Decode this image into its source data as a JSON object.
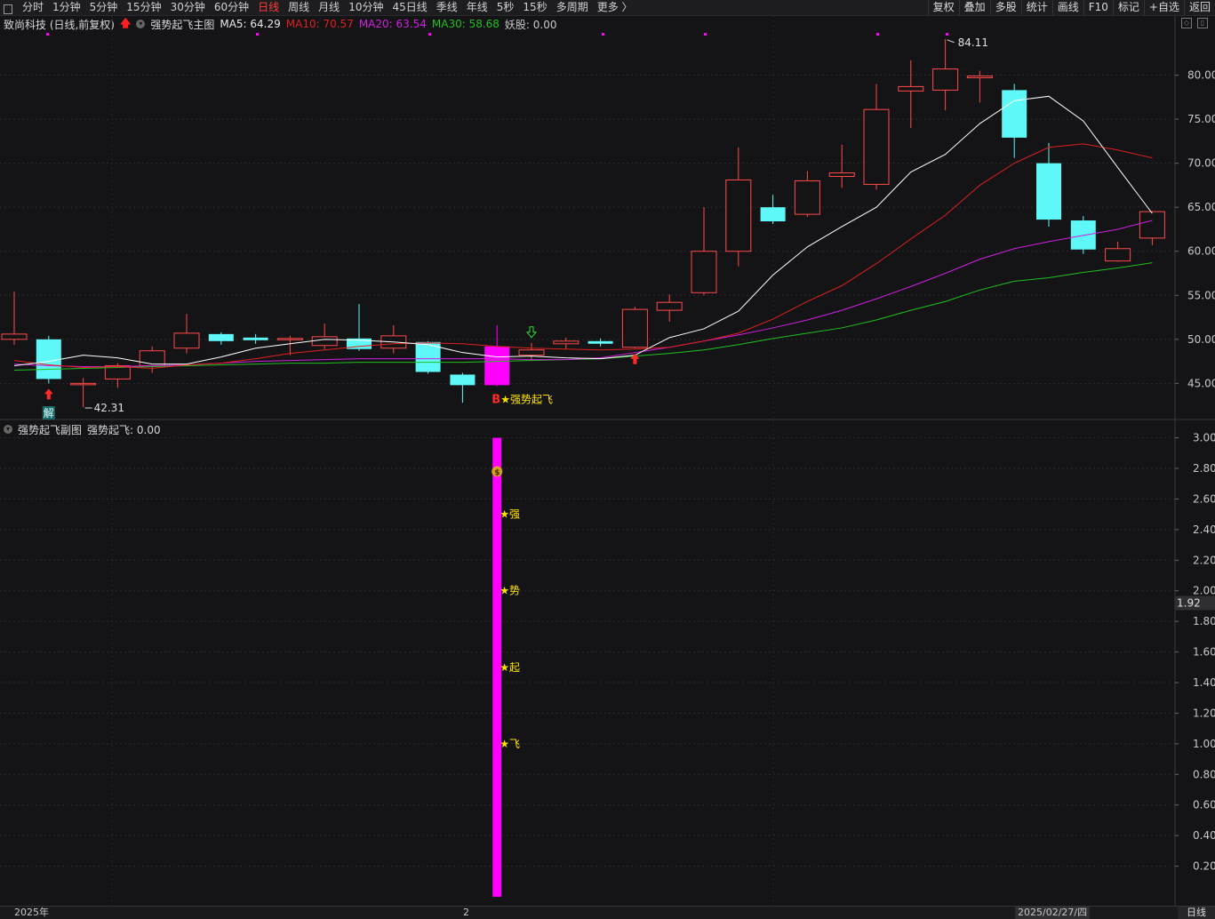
{
  "toolbar": {
    "periods": [
      "分时",
      "1分钟",
      "5分钟",
      "15分钟",
      "30分钟",
      "60分钟",
      "日线",
      "周线",
      "月线",
      "10分钟",
      "45日线",
      "季线",
      "年线",
      "5秒",
      "15秒",
      "多周期",
      "更多 〉"
    ],
    "active_period": "日线",
    "right_tools": [
      "复权",
      "叠加",
      "多股",
      "统计",
      "画线",
      "F10",
      "标记",
      "+自选",
      "返回"
    ]
  },
  "main_panel": {
    "stock": "致尚科技 (日线,前复权)",
    "indicator": "强势起飞主图",
    "ma5": "MA5: 64.29",
    "ma10": "MA10: 70.57",
    "ma20": "MA20: 63.54",
    "ma30": "MA30: 58.68",
    "yaogu": "妖股: 0.00",
    "high_label": "84.11",
    "low_label": "42.31",
    "signal_b": "B",
    "signal_text": "★强势起飞",
    "jie": "解"
  },
  "sub_panel": {
    "indicator": "强势起飞副图",
    "value": "强势起飞: 0.00",
    "chars": [
      "★强",
      "★势",
      "★起",
      "★飞"
    ],
    "cursor_value": "1.92",
    "money_icon": "money-bag-icon"
  },
  "bottom": {
    "date_start": "2025年",
    "date_mid": "2",
    "date_cursor": "2025/02/27/四",
    "period": "日线"
  },
  "colors": {
    "up": "#ff4a4a",
    "down": "#5ff8f8",
    "ma5": "#ffffff",
    "ma10": "#e02020",
    "ma20": "#d020e0",
    "ma30": "#20c020",
    "signal": "#ff00ff",
    "text_yellow": "#ffe400"
  },
  "chart_data": [
    {
      "type": "candlestick",
      "ylim": [
        41,
        85
      ],
      "yticks": [
        45,
        50,
        55,
        60,
        65,
        70,
        75,
        80
      ],
      "ytick_labels": [
        "45.00",
        "50.00",
        "55.00",
        "60.00",
        "65.00",
        "70.00",
        "75.00",
        "80.00"
      ],
      "candles": [
        {
          "o": 50.0,
          "c": 50.6,
          "h": 55.4,
          "l": 49.4
        },
        {
          "o": 50.0,
          "c": 45.5,
          "h": 50.4,
          "l": 45.0
        },
        {
          "o": 45.0,
          "c": 45.0,
          "h": 45.6,
          "l": 42.3
        },
        {
          "o": 45.5,
          "c": 47.0,
          "h": 47.3,
          "l": 44.5
        },
        {
          "o": 47.0,
          "c": 48.7,
          "h": 49.2,
          "l": 46.2
        },
        {
          "o": 49.0,
          "c": 50.7,
          "h": 52.9,
          "l": 48.4
        },
        {
          "o": 50.6,
          "c": 49.8,
          "h": 50.8,
          "l": 49.4
        },
        {
          "o": 50.2,
          "c": 49.9,
          "h": 50.6,
          "l": 49.5
        },
        {
          "o": 50.0,
          "c": 50.1,
          "h": 50.4,
          "l": 48.2
        },
        {
          "o": 49.3,
          "c": 50.3,
          "h": 51.8,
          "l": 48.9
        },
        {
          "o": 50.1,
          "c": 48.9,
          "h": 54.0,
          "l": 48.7
        },
        {
          "o": 49.0,
          "c": 50.4,
          "h": 51.6,
          "l": 48.4
        },
        {
          "o": 49.7,
          "c": 46.3,
          "h": 49.8,
          "l": 46.1
        },
        {
          "o": 46.0,
          "c": 44.8,
          "h": 46.2,
          "l": 42.8
        },
        {
          "o": 44.8,
          "c": 49.2,
          "h": 51.6,
          "l": 44.7
        },
        {
          "o": 48.2,
          "c": 48.8,
          "h": 49.6,
          "l": 47.7
        },
        {
          "o": 49.5,
          "c": 49.8,
          "h": 50.2,
          "l": 48.9
        },
        {
          "o": 49.8,
          "c": 49.5,
          "h": 50.1,
          "l": 49.2
        },
        {
          "o": 49.1,
          "c": 53.4,
          "h": 53.7,
          "l": 49.0
        },
        {
          "o": 53.3,
          "c": 54.2,
          "h": 55.1,
          "l": 52.0
        },
        {
          "o": 55.3,
          "c": 60.0,
          "h": 65.0,
          "l": 55.0
        },
        {
          "o": 60.0,
          "c": 68.1,
          "h": 71.8,
          "l": 58.3
        },
        {
          "o": 65.0,
          "c": 63.4,
          "h": 66.4,
          "l": 63.1
        },
        {
          "o": 64.2,
          "c": 68.0,
          "h": 69.1,
          "l": 63.9
        },
        {
          "o": 68.5,
          "c": 68.9,
          "h": 72.1,
          "l": 67.2
        },
        {
          "o": 67.6,
          "c": 76.1,
          "h": 79.0,
          "l": 67.0
        },
        {
          "o": 78.2,
          "c": 78.7,
          "h": 81.7,
          "l": 74.0
        },
        {
          "o": 78.3,
          "c": 80.7,
          "h": 84.1,
          "l": 76.0
        },
        {
          "o": 79.7,
          "c": 79.9,
          "h": 80.5,
          "l": 76.9
        },
        {
          "o": 78.3,
          "c": 72.9,
          "h": 79.0,
          "l": 70.6
        },
        {
          "o": 70.0,
          "c": 63.6,
          "h": 72.3,
          "l": 62.8
        },
        {
          "o": 63.5,
          "c": 60.2,
          "h": 64.0,
          "l": 59.7
        },
        {
          "o": 58.9,
          "c": 60.3,
          "h": 61.1,
          "l": 58.8
        },
        {
          "o": 61.5,
          "c": 64.5,
          "h": 64.6,
          "l": 60.7
        }
      ],
      "ma5": [
        47.0,
        47.5,
        48.2,
        47.9,
        47.2,
        47.2,
        48.0,
        49.0,
        49.5,
        50.0,
        49.9,
        49.7,
        49.4,
        48.5,
        48.0,
        48.1,
        47.9,
        47.8,
        48.2,
        50.2,
        51.2,
        53.2,
        57.3,
        60.5,
        62.8,
        65.0,
        69.0,
        71.0,
        74.5,
        77.1,
        77.6,
        74.8,
        69.5,
        64.3
      ],
      "ma10": [
        47.6,
        47.1,
        46.8,
        46.9,
        46.7,
        47.1,
        47.3,
        47.8,
        48.4,
        48.8,
        49.2,
        49.5,
        49.6,
        49.5,
        49.2,
        49.0,
        48.9,
        48.8,
        48.9,
        49.1,
        49.8,
        50.7,
        52.3,
        54.3,
        56.1,
        58.6,
        61.4,
        64.1,
        67.5,
        70.0,
        71.8,
        72.2,
        71.5,
        70.6
      ],
      "ma20": [
        47.2,
        47.0,
        46.9,
        46.9,
        47.0,
        47.1,
        47.3,
        47.5,
        47.6,
        47.7,
        47.8,
        47.8,
        47.8,
        47.8,
        47.8,
        47.7,
        47.7,
        47.9,
        48.5,
        49.1,
        49.8,
        50.5,
        51.3,
        52.2,
        53.3,
        54.6,
        56.0,
        57.5,
        59.1,
        60.3,
        61.1,
        61.8,
        62.5,
        63.5
      ],
      "ma30": [
        46.5,
        46.6,
        46.7,
        46.8,
        46.9,
        47.0,
        47.1,
        47.2,
        47.3,
        47.3,
        47.4,
        47.4,
        47.4,
        47.4,
        47.5,
        47.6,
        47.7,
        47.8,
        48.1,
        48.4,
        48.8,
        49.4,
        50.1,
        50.7,
        51.3,
        52.2,
        53.3,
        54.3,
        55.6,
        56.6,
        57.0,
        57.6,
        58.1,
        58.7
      ],
      "up_arrows": [
        1,
        18
      ],
      "down_arrows": [
        15
      ],
      "signal_candle": 14,
      "high_annotation": {
        "candle": 27,
        "value": 84.11
      },
      "low_annotation": {
        "candle": 2,
        "value": 42.31
      }
    },
    {
      "type": "bar",
      "ylim": [
        0,
        3.05
      ],
      "yticks": [
        0.2,
        0.4,
        0.6,
        0.8,
        1.0,
        1.2,
        1.4,
        1.6,
        1.8,
        2.0,
        2.2,
        2.4,
        2.6,
        2.8,
        3.0
      ],
      "ytick_labels": [
        "0.20",
        "0.40",
        "0.60",
        "0.80",
        "1.00",
        "1.20",
        "1.40",
        "1.60",
        "1.80",
        "2.00",
        "2.20",
        "2.40",
        "2.60",
        "2.80",
        "3.00"
      ],
      "bar": {
        "candle": 14,
        "from": 0,
        "to": 3.0
      },
      "char_levels": [
        2.5,
        2.0,
        1.5,
        1.0
      ],
      "icon_level": 2.78
    }
  ]
}
